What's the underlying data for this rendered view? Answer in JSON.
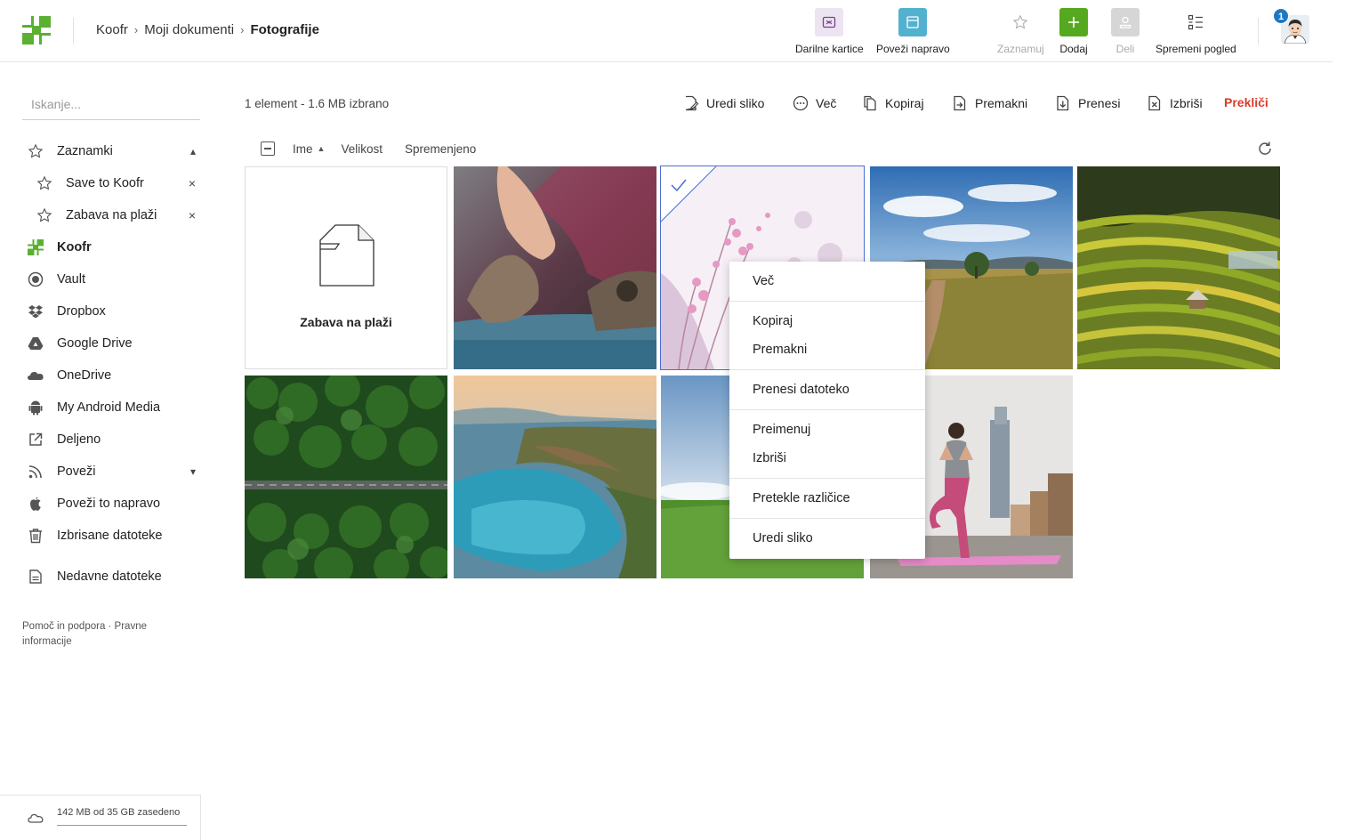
{
  "breadcrumb": {
    "root": "Koofr",
    "parent": "Moji dokumenti",
    "current": "Fotografije"
  },
  "toolbar": {
    "gift_cards": "Darilne kartice",
    "connect_device": "Poveži napravo",
    "bookmark": "Zaznamuj",
    "add": "Dodaj",
    "share": "Deli",
    "change_view": "Spremeni pogled"
  },
  "notifications": {
    "count": "1"
  },
  "search": {
    "placeholder": "Iskanje..."
  },
  "sidebar": {
    "bookmarks": "Zaznamki",
    "bookmark_items": [
      "Save to Koofr",
      "Zabava na plaži"
    ],
    "items": [
      "Koofr",
      "Vault",
      "Dropbox",
      "Google Drive",
      "OneDrive",
      "My Android Media",
      "Deljeno",
      "Poveži",
      "Poveži to napravo",
      "Izbrisane datoteke",
      "Nedavne datoteke"
    ],
    "footer": "Pomoč in podpora · Pravne informacije",
    "storage": "142 MB od 35 GB zasedeno"
  },
  "selection": {
    "info": "1 element - 1.6 MB izbrano"
  },
  "actions": {
    "edit_image": "Uredi sliko",
    "more": "Več",
    "copy": "Kopiraj",
    "move": "Premakni",
    "download": "Prenesi",
    "delete": "Izbriši",
    "cancel": "Prekliči"
  },
  "columns": {
    "name": "Ime",
    "size": "Velikost",
    "modified": "Spremenjeno"
  },
  "files": {
    "folder_name": "Zabava na plaži"
  },
  "context_menu": {
    "more": "Več",
    "copy": "Kopiraj",
    "move": "Premakni",
    "download_files": "Prenesi datoteko",
    "rename": "Preimenuj",
    "delete": "Izbriši",
    "expired_versions": "Pretekle različice",
    "edit_image": "Uredi sliko"
  },
  "colors": {
    "brand_green": "#6cc04a",
    "cancel_red": "#d83c2a",
    "selection_blue": "#4a6fd0",
    "badge_blue": "#1f78c1"
  }
}
